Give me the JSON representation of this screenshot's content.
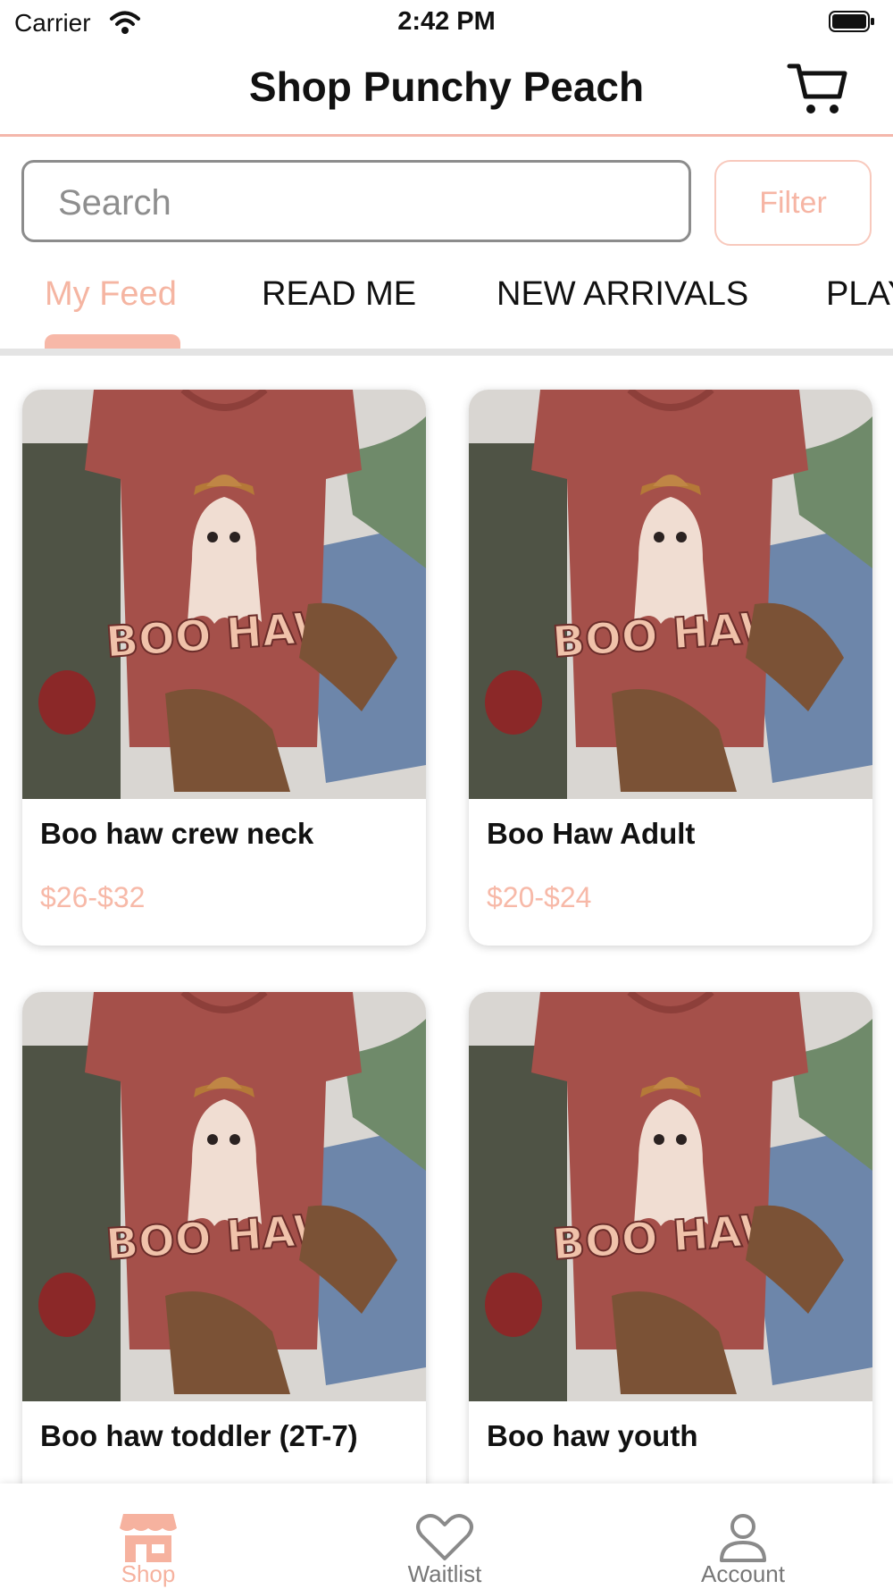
{
  "status_bar": {
    "carrier": "Carrier",
    "time": "2:42 PM"
  },
  "header": {
    "title": "Shop Punchy Peach",
    "cart_icon": "cart-icon"
  },
  "search": {
    "placeholder": "Search",
    "value": ""
  },
  "filter": {
    "label": "Filter"
  },
  "tabs": [
    {
      "label": "My Feed",
      "active": true
    },
    {
      "label": "READ ME",
      "active": false
    },
    {
      "label": "NEW ARRIVALS",
      "active": false
    },
    {
      "label": "PLAY",
      "active": false
    }
  ],
  "products": [
    {
      "name": "Boo haw crew neck",
      "price": "$26-$32",
      "image_text": "BOO HAW"
    },
    {
      "name": "Boo Haw Adult",
      "price": "$20-$24",
      "image_text": "BOO HAW"
    },
    {
      "name": "Boo haw toddler (2T-7)",
      "price": "",
      "image_text": "BOO HAW"
    },
    {
      "name": "Boo haw youth",
      "price": "",
      "image_text": "BOO HAW"
    }
  ],
  "bottom_nav": [
    {
      "label": "Shop",
      "icon": "shop-icon",
      "active": true
    },
    {
      "label": "Waitlist",
      "icon": "heart-icon",
      "active": false
    },
    {
      "label": "Account",
      "icon": "person-icon",
      "active": false
    }
  ],
  "colors": {
    "accent": "#f6b5a4",
    "header_rule": "#f4b7ab",
    "shirt": "#a5504a"
  }
}
